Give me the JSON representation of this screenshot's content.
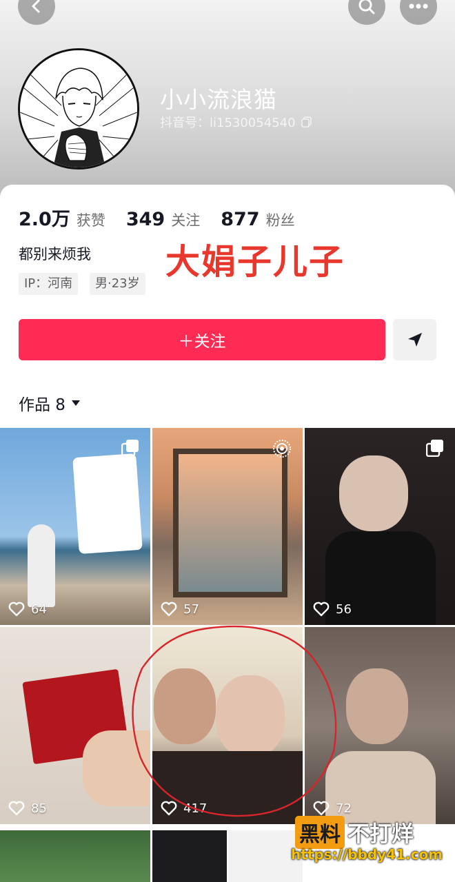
{
  "profile": {
    "nickname": "小小流浪猫",
    "douyin_id": "抖音号：li1530054540",
    "bio": "都别来烦我",
    "tags": [
      "IP：河南",
      "男·23岁"
    ]
  },
  "stats": [
    {
      "num": "2.0万",
      "label": "获赞"
    },
    {
      "num": "349",
      "label": "关注"
    },
    {
      "num": "877",
      "label": "粉丝"
    }
  ],
  "annotation": "大娟子儿子",
  "actions": {
    "follow_label": "＋关注"
  },
  "works": {
    "label": "作品 8"
  },
  "grid": [
    {
      "likes": "64",
      "corner": "multi-image-icon"
    },
    {
      "likes": "57",
      "corner": "live-photo-icon"
    },
    {
      "likes": "56",
      "corner": "multi-image-icon"
    },
    {
      "likes": "85",
      "corner": ""
    },
    {
      "likes": "417",
      "corner": ""
    },
    {
      "likes": "72",
      "corner": ""
    }
  ],
  "watermark": {
    "brand_box": "黑料",
    "brand_rest": "不打烊",
    "url": "https://bbdy41.com"
  },
  "colors": {
    "accent": "#fe2c55",
    "annotation": "#e8372c"
  }
}
